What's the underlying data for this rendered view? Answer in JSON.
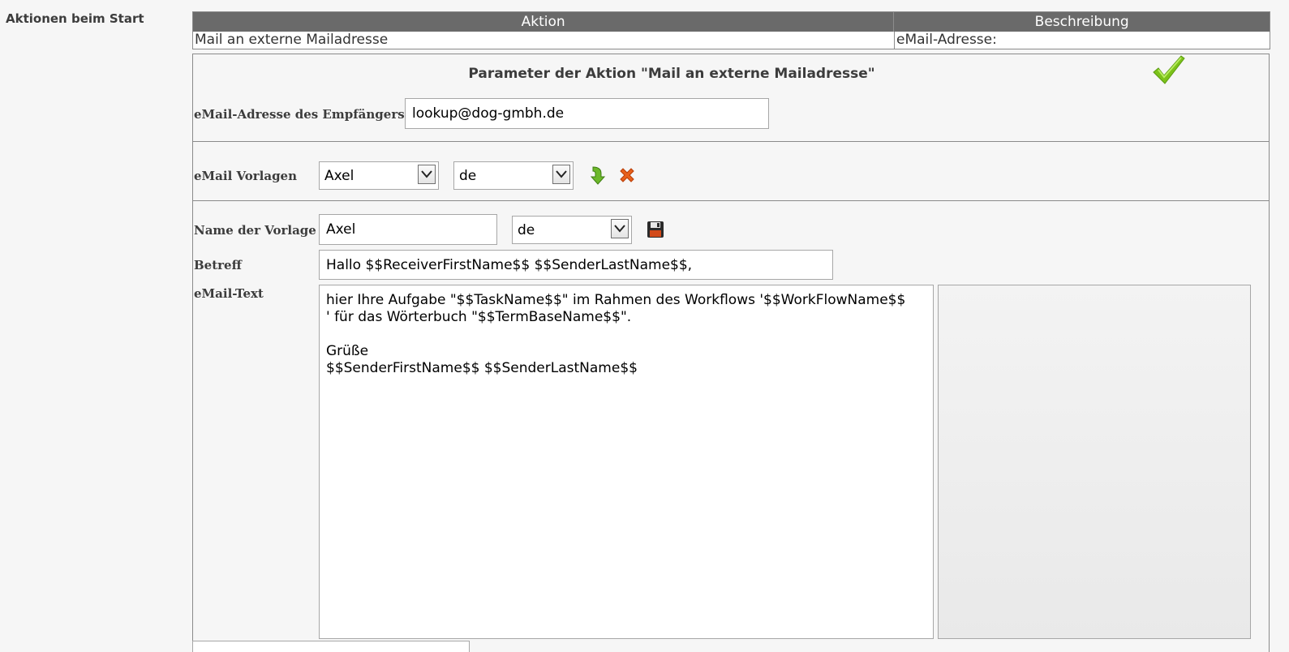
{
  "sidebar": {
    "title": "Aktionen beim Start"
  },
  "actions_table": {
    "headers": {
      "aktion": "Aktion",
      "beschreibung": "Beschreibung"
    },
    "row": {
      "aktion": "Mail an externe Mailadresse",
      "beschreibung": "eMail-Adresse:"
    }
  },
  "parameters": {
    "title": "Parameter der Aktion \"Mail an externe Mailadresse\"",
    "confirm_icon": "checkmark-icon",
    "recipient": {
      "label": "eMail-Adresse des Empfängers",
      "value": "lookup@dog-gmbh.de"
    }
  },
  "templates": {
    "label": "eMail Vorlagen",
    "template_select": "Axel",
    "language_select": "de",
    "load_icon": "green-arrow-down-icon",
    "delete_icon": "red-x-icon"
  },
  "template_editor": {
    "name_label": "Name der Vorlage",
    "name_value": "Axel",
    "language_select": "de",
    "save_icon": "floppy-disk-icon",
    "subject_label": "Betreff",
    "subject_value": "Hallo $$ReceiverFirstName$$ $$SenderLastName$$,",
    "body_label": "eMail-Text",
    "body_value": "hier Ihre Aufgabe \"$$TaskName$$\" im Rahmen des Workflows '$$WorkFlowName$$\n' für das Wörterbuch \"$$TermBaseName$$\".\n\nGrüße\n$$SenderFirstName$$ $$SenderLastName$$"
  },
  "colors": {
    "header_bg": "#6a6a6a",
    "page_bg": "#f6f6f6",
    "check_green": "#7cc21a",
    "delete_orange": "#e8601a"
  }
}
